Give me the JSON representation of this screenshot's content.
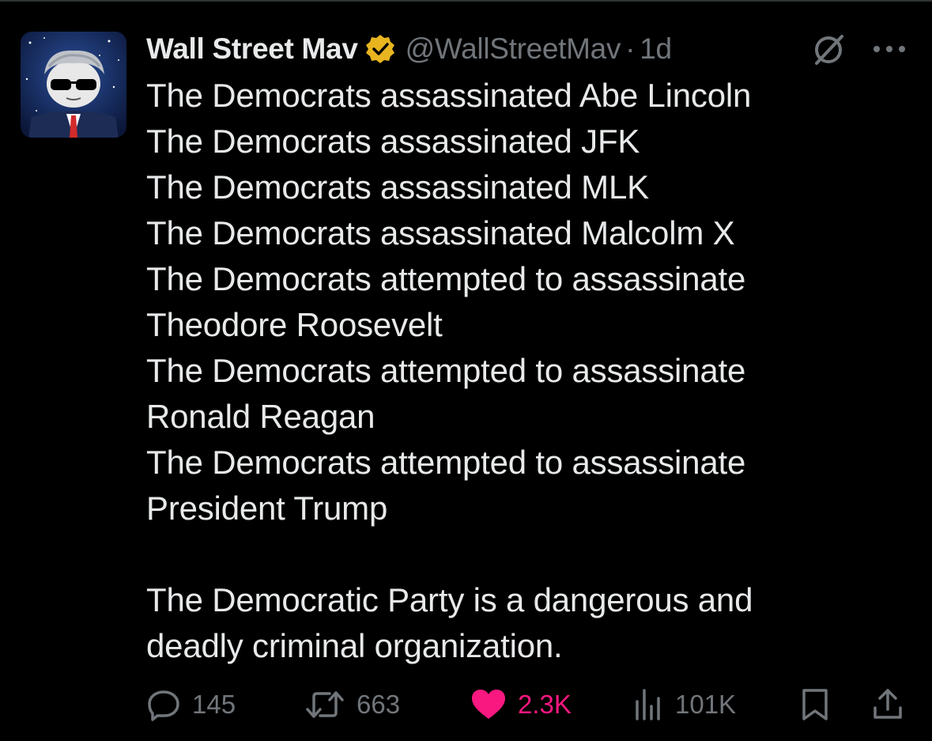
{
  "post": {
    "author_name": "Wall Street Mav",
    "handle": "@WallStreetMav",
    "separator": "·",
    "time": "1d",
    "verified_icon": "gold-verified-badge-icon",
    "avatar": "cartoon-avatar-white-hair-sunglasses-suit",
    "body_lines": [
      "The Democrats assassinated Abe Lincoln",
      "The Democrats assassinated JFK",
      "The Democrats assassinated MLK",
      "The Democrats assassinated Malcolm X",
      "The Democrats attempted to assassinate",
      "Theodore Roosevelt",
      "The Democrats attempted to assassinate",
      "Ronald Reagan",
      "The Democrats attempted to assassinate",
      "President Trump",
      "",
      "The Democratic Party is a dangerous and",
      "deadly criminal organization."
    ]
  },
  "actions": {
    "replies": "145",
    "reposts": "663",
    "likes": "2.3K",
    "views": "101K"
  },
  "colors": {
    "background": "#000000",
    "text": "#e7e9ea",
    "secondary": "#71767b",
    "like": "#f91880",
    "verified": "#e8b520"
  }
}
